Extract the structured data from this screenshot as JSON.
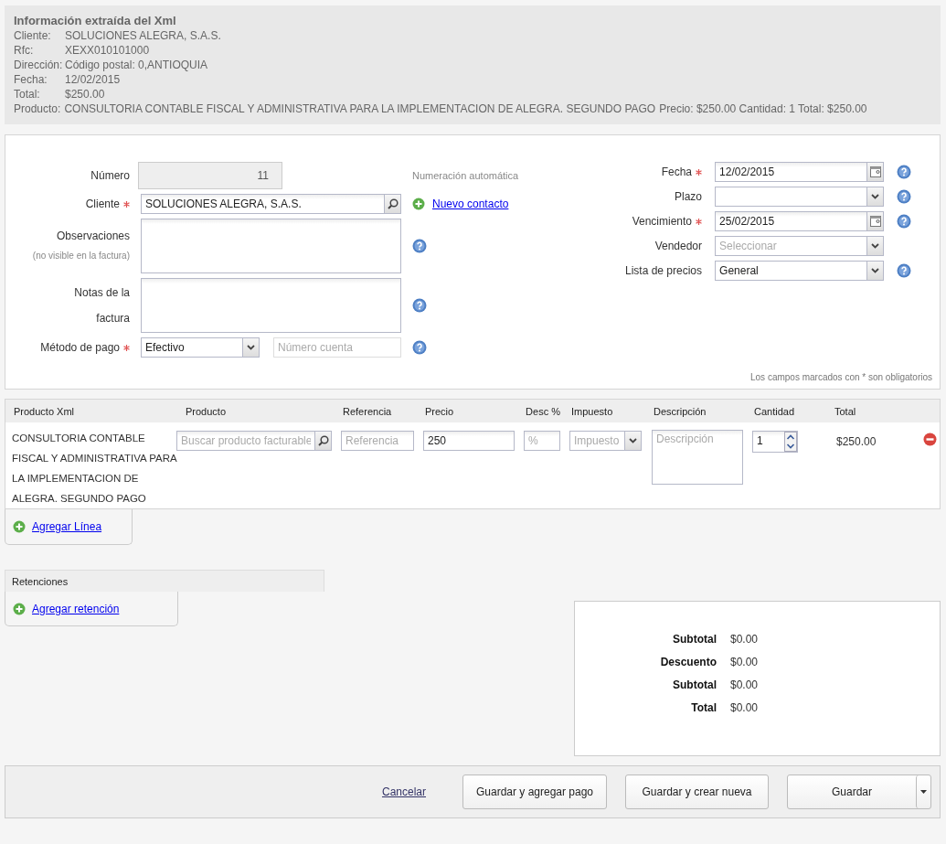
{
  "xml_info": {
    "title": "Información extraída del Xml",
    "fields": [
      {
        "label": "Cliente:",
        "value": "SOLUCIONES ALEGRA, S.A.S."
      },
      {
        "label": "Rfc:",
        "value": "XEXX010101000"
      },
      {
        "label": "Dirección:",
        "value": "Código postal: 0,ANTIOQUIA"
      },
      {
        "label": "Fecha:",
        "value": "12/02/2015"
      },
      {
        "label": "Total:",
        "value": "$250.00"
      }
    ],
    "product": {
      "label": "Producto:",
      "value": "CONSULTORIA CONTABLE FISCAL Y ADMINISTRATIVA PARA LA IMPLEMENTACION DE ALEGRA. SEGUNDO PAGO",
      "details": "Precio: $250.00 Cantidad: 1 Total: $250.00"
    }
  },
  "form": {
    "left_fields": [
      {
        "kind": "number",
        "label": "Número",
        "required": false,
        "help": false,
        "value": "11",
        "note": "Numeración automática"
      },
      {
        "kind": "search",
        "label": "Cliente",
        "required": true,
        "help": false,
        "value": "SOLUCIONES ALEGRA, S.A.S.",
        "link": "Nuevo contacto"
      },
      {
        "kind": "textarea",
        "label": "Observaciones",
        "required": false,
        "help": true,
        "sublabel": "(no visible en la factura)"
      },
      {
        "kind": "textarea",
        "label": "Notas de la factura",
        "required": false,
        "help": true
      },
      {
        "kind": "select",
        "label": "Método de pago",
        "required": true,
        "help": true,
        "value": "Efectivo",
        "extra_placeholder": "Número cuenta"
      }
    ],
    "right_fields": [
      {
        "kind": "date",
        "label": "Fecha",
        "required": true,
        "help": true,
        "value": "12/02/2015"
      },
      {
        "kind": "select",
        "label": "Plazo",
        "required": false,
        "help": true
      },
      {
        "kind": "date",
        "label": "Vencimiento",
        "required": true,
        "help": true,
        "value": "25/02/2015"
      },
      {
        "kind": "select",
        "label": "Vendedor",
        "required": false,
        "help": false,
        "placeholder": "Seleccionar"
      },
      {
        "kind": "select",
        "label": "Lista de precios",
        "required": false,
        "help": true,
        "value": "General"
      }
    ],
    "required_note": "Los campos marcados con * son obligatorios"
  },
  "items": {
    "columns": [
      "Producto Xml",
      "Producto",
      "Referencia",
      "Precio",
      "Desc %",
      "Impuesto",
      "Descripción",
      "Cantidad",
      "Total"
    ],
    "rows": [
      {
        "product_xml": "CONSULTORIA CONTABLE FISCAL Y ADMINISTRATIVA PARA LA IMPLEMENTACION DE ALEGRA. SEGUNDO PAGO",
        "product_placeholder": "Buscar producto facturable",
        "reference_placeholder": "Referencia",
        "price": "250",
        "discount_placeholder": "%",
        "tax_placeholder": "Impuesto",
        "description_placeholder": "Descripción",
        "quantity": "1",
        "total": "$250.00"
      }
    ],
    "add_line": "Agregar Línea"
  },
  "retentions": {
    "title": "Retenciones",
    "add": "Agregar retención"
  },
  "totals": [
    {
      "label": "Subtotal",
      "value": "$0.00"
    },
    {
      "label": "Descuento",
      "value": "$0.00"
    },
    {
      "label": "Subtotal",
      "value": "$0.00"
    },
    {
      "label": "Total",
      "value": "$0.00"
    }
  ],
  "actions": {
    "cancel": "Cancelar",
    "buttons": [
      "Guardar y agregar pago",
      "Guardar y crear nueva",
      "Guardar"
    ]
  }
}
